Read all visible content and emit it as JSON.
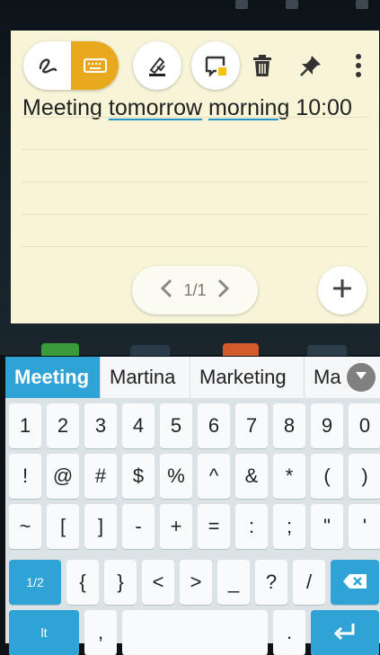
{
  "toolbar": {
    "icons": [
      "handwriting-icon",
      "keyboard-icon",
      "highlighter-icon",
      "sticky-note-icon",
      "trash-icon",
      "pin-icon",
      "more-vert-icon"
    ]
  },
  "note": {
    "words": [
      "Meeting ",
      "tomorrow",
      " ",
      "morning",
      " 10:00"
    ],
    "pager": {
      "label": "1/1"
    }
  },
  "suggestions": [
    "Meeting",
    "Martina",
    "Marketing",
    "Ma"
  ],
  "keyboard": {
    "row1": [
      "1",
      "2",
      "3",
      "4",
      "5",
      "6",
      "7",
      "8",
      "9",
      "0"
    ],
    "row2": [
      "!",
      "@",
      "#",
      "$",
      "%",
      "^",
      "&",
      "*",
      "(",
      ")"
    ],
    "row3": [
      "~",
      "[",
      "]",
      "-",
      "+",
      "=",
      ":",
      ";",
      "\"",
      "'"
    ],
    "row4": [
      "1/2",
      "{",
      "}",
      "<",
      ">",
      "_",
      "?",
      "/"
    ],
    "row5": [
      "lt",
      ",",
      ".",
      ""
    ]
  },
  "colors": {
    "accent": "#2fa3d6",
    "note_bg": "#f7f4d8",
    "keyboard_active": "#e8a91f"
  }
}
